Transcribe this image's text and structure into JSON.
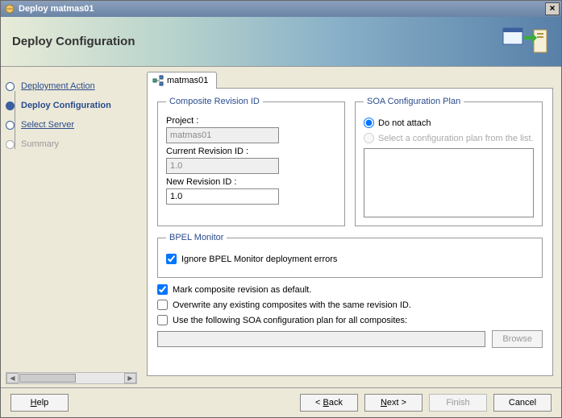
{
  "window": {
    "title": "Deploy matmas01"
  },
  "banner": {
    "title": "Deploy Configuration"
  },
  "sidebar": {
    "steps": [
      {
        "label": "Deployment Action",
        "state": "done"
      },
      {
        "label": "Deploy Configuration",
        "state": "current"
      },
      {
        "label": "Select Server",
        "state": "done"
      },
      {
        "label": "Summary",
        "state": "pending"
      }
    ]
  },
  "tab": {
    "label": "matmas01"
  },
  "composite": {
    "legend": "Composite Revision ID",
    "project_label": "Project :",
    "project_value": "matmas01",
    "current_rev_label": "Current Revision ID :",
    "current_rev_value": "1.0",
    "new_rev_label": "New Revision ID :",
    "new_rev_value": "1.0"
  },
  "soa": {
    "legend": "SOA Configuration Plan",
    "opt_none": "Do not attach",
    "opt_select": "Select a configuration plan from the list."
  },
  "bpel": {
    "legend": "BPEL Monitor",
    "ignore": "Ignore BPEL Monitor deployment errors"
  },
  "options": {
    "mark_default": "Mark composite revision as default.",
    "overwrite": "Overwrite any existing composites with the same revision ID.",
    "use_plan": "Use the following SOA configuration plan for all composites:",
    "browse": "Browse"
  },
  "footer": {
    "help": "Help",
    "back": "< Back",
    "next": "Next >",
    "finish": "Finish",
    "cancel": "Cancel"
  }
}
